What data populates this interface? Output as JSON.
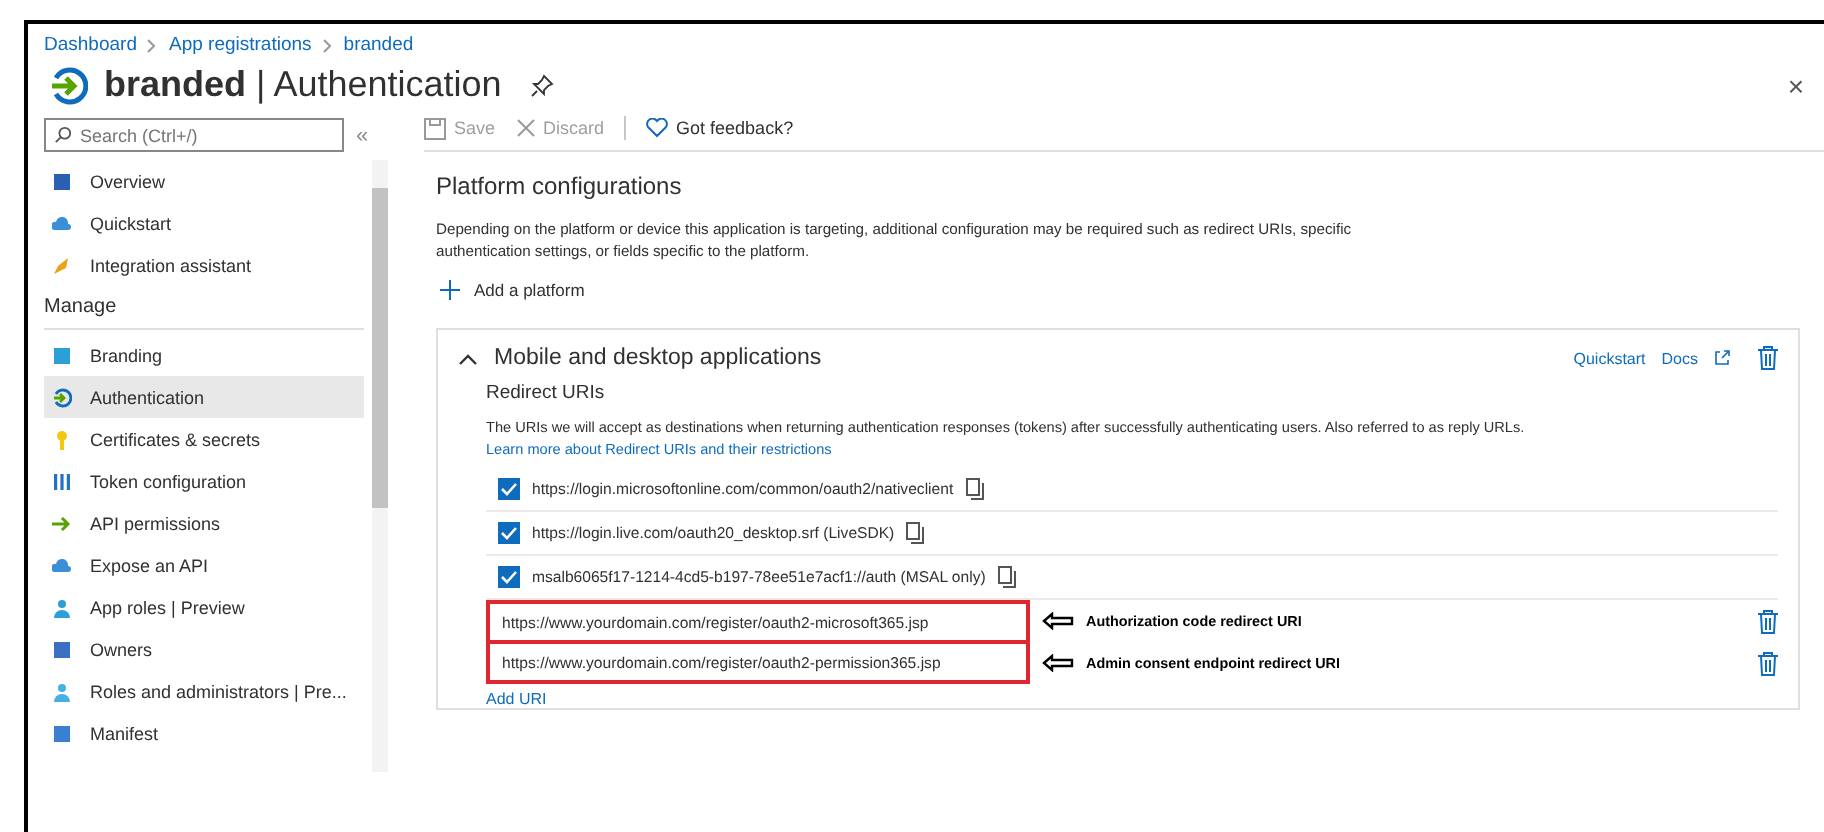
{
  "breadcrumb": [
    "Dashboard",
    "App registrations",
    "branded"
  ],
  "title": {
    "app": "branded",
    "separator": "|",
    "page": "Authentication"
  },
  "close": "×",
  "sidebar": {
    "search_placeholder": "Search (Ctrl+/)",
    "collapse": "«",
    "items": [
      {
        "label": "Overview",
        "kind": "item",
        "selected": false
      },
      {
        "label": "Quickstart",
        "kind": "item",
        "selected": false
      },
      {
        "label": "Integration assistant",
        "kind": "item",
        "selected": false
      },
      {
        "label": "Manage",
        "kind": "header"
      },
      {
        "label": "Branding",
        "kind": "item",
        "selected": false
      },
      {
        "label": "Authentication",
        "kind": "item",
        "selected": true
      },
      {
        "label": "Certificates & secrets",
        "kind": "item",
        "selected": false
      },
      {
        "label": "Token configuration",
        "kind": "item",
        "selected": false
      },
      {
        "label": "API permissions",
        "kind": "item",
        "selected": false
      },
      {
        "label": "Expose an API",
        "kind": "item",
        "selected": false
      },
      {
        "label": "App roles | Preview",
        "kind": "item",
        "selected": false
      },
      {
        "label": "Owners",
        "kind": "item",
        "selected": false
      },
      {
        "label": "Roles and administrators | Pre...",
        "kind": "item",
        "selected": false
      },
      {
        "label": "Manifest",
        "kind": "item",
        "selected": false
      }
    ]
  },
  "toolbar": {
    "save": "Save",
    "discard": "Discard",
    "feedback": "Got feedback?"
  },
  "section": {
    "heading": "Platform configurations",
    "description": "Depending on the platform or device this application is targeting, additional configuration may be required such as redirect URIs, specific authentication settings, or fields specific to the platform.",
    "add": "Add a platform"
  },
  "platform": {
    "title": "Mobile and desktop applications",
    "expanded": true,
    "quickstart": "Quickstart",
    "docs": "Docs",
    "subheading": "Redirect URIs",
    "description": "The URIs we will accept as destinations when returning authentication responses (tokens) after successfully authenticating users. Also referred to as reply URLs.",
    "learn_more": "Learn more about Redirect URIs and their restrictions",
    "uris": [
      {
        "kind": "suggested",
        "value": "https://login.microsoftonline.com/common/oauth2/nativeclient",
        "checked": true
      },
      {
        "kind": "suggested",
        "value": "https://login.live.com/oauth20_desktop.srf (LiveSDK)",
        "checked": true
      },
      {
        "kind": "suggested",
        "value": "msalb6065f17-1214-4cd5-b197-78ee51e7acf1://auth (MSAL only)",
        "checked": true
      },
      {
        "kind": "custom",
        "value": "https://www.yourdomain.com/register/oauth2-microsoft365.jsp",
        "annotation": "Authorization code redirect URI"
      },
      {
        "kind": "custom",
        "value": "https://www.yourdomain.com/register/oauth2-permission365.jsp",
        "annotation": "Admin consent endpoint redirect URI"
      }
    ],
    "add_uri": "Add URI"
  }
}
